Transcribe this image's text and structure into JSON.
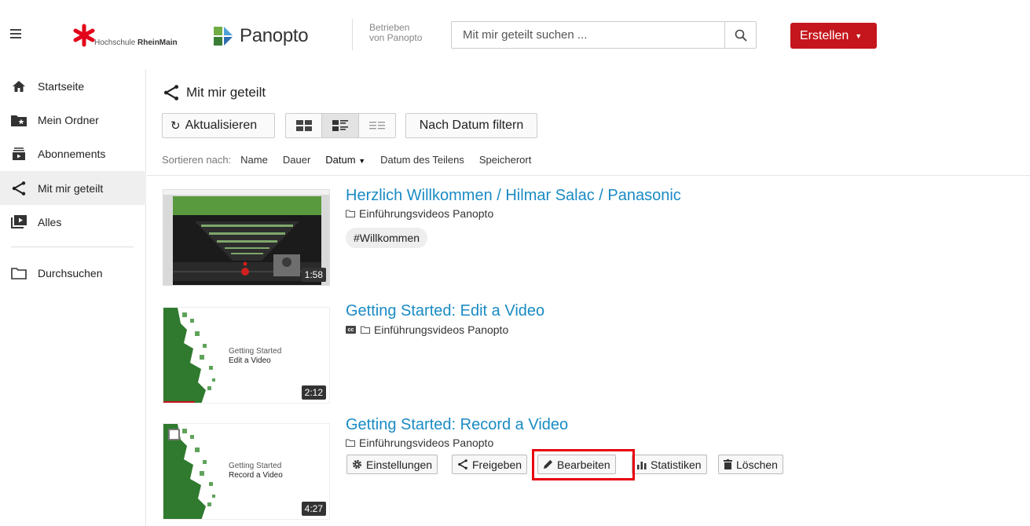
{
  "header": {
    "logo_hsrm_prefix": "Hochschule ",
    "logo_hsrm_bold": "RheinMain",
    "logo_panopto": "Panopto",
    "powered_line1": "Betrieben",
    "powered_line2": "von Panopto",
    "search_placeholder": "Mit mir geteilt suchen ...",
    "create_label": "Erstellen",
    "accent_color": "#c4161c"
  },
  "sidebar": {
    "items": [
      {
        "label": "Startseite",
        "icon": "home-icon"
      },
      {
        "label": "Mein Ordner",
        "icon": "starred-folder-icon"
      },
      {
        "label": "Abonnements",
        "icon": "subscriptions-icon"
      },
      {
        "label": "Mit mir geteilt",
        "icon": "share-icon",
        "active": true
      },
      {
        "label": "Alles",
        "icon": "playlist-icon"
      },
      {
        "label": "Durchsuchen",
        "icon": "folder-icon"
      }
    ]
  },
  "main": {
    "title": "Mit mir geteilt",
    "refresh_label": "Aktualisieren",
    "filter_label": "Nach Datum filtern",
    "sort_label": "Sortieren nach:",
    "sort_options": [
      "Name",
      "Dauer",
      "Datum",
      "Datum des Teilens",
      "Speicherort"
    ],
    "sort_active": "Datum",
    "sessions": [
      {
        "title": "Herzlich Willkommen / Hilmar Salac / Panasonic",
        "folder": "Einführungsvideos Panopto",
        "duration": "1:58",
        "tag": "#Willkommen"
      },
      {
        "title": "Getting Started: Edit a Video",
        "folder": "Einführungsvideos Panopto",
        "duration": "2:12",
        "thumb_line1": "Getting Started",
        "thumb_line2": "Edit a Video",
        "captions": "cc"
      },
      {
        "title": "Getting Started: Record a Video",
        "folder": "Einführungsvideos Panopto",
        "duration": "4:27",
        "thumb_line1": "Getting Started",
        "thumb_line2": "Record a Video",
        "actions": [
          "Einstellungen",
          "Freigeben",
          "Bearbeiten",
          "Statistiken",
          "Löschen"
        ],
        "highlighted_action": "Bearbeiten"
      }
    ]
  }
}
